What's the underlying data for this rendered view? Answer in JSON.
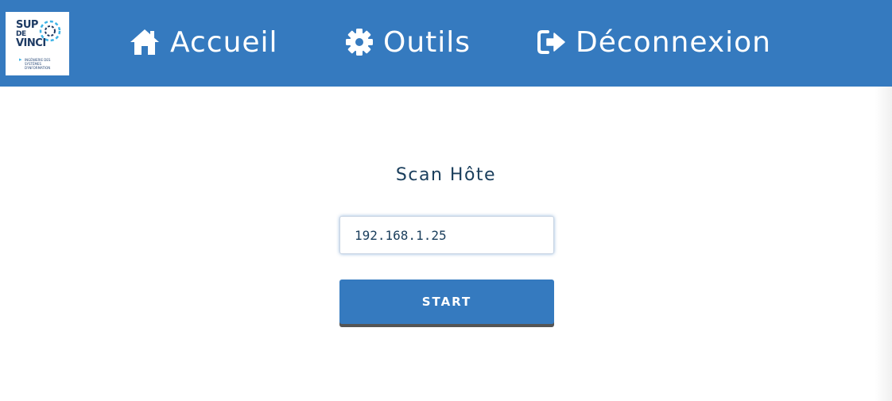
{
  "nav": {
    "logo": {
      "line1": "SUP",
      "line2": "DE",
      "line3": "VINCI",
      "subtitle": "INGÉNIERIE DES SYSTÈMES D'INFORMATION"
    },
    "items": [
      {
        "label": "Accueil",
        "icon": "home-icon"
      },
      {
        "label": "Outils",
        "icon": "gear-icon"
      },
      {
        "label": "Déconnexion",
        "icon": "sign-out-icon"
      }
    ]
  },
  "main": {
    "title": "Scan Hôte",
    "host_input": {
      "value": "192.168.1.25",
      "placeholder": ""
    },
    "start_label": "START"
  },
  "colors": {
    "primary": "#357ABF",
    "heading": "#1a3e5c",
    "button_shadow": "#555555"
  }
}
